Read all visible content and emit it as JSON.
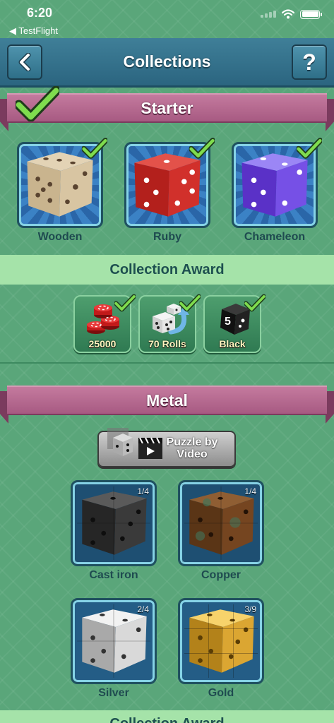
{
  "status_bar": {
    "time": "6:20",
    "back_app": "◀ TestFlight"
  },
  "navbar": {
    "title": "Collections",
    "back_icon": "chevron-left-icon",
    "help_label": "?"
  },
  "sections": {
    "starter": {
      "title": "Starter",
      "dice": [
        {
          "label": "Wooden",
          "collected": true
        },
        {
          "label": "Ruby",
          "collected": true
        },
        {
          "label": "Chameleon",
          "collected": true
        }
      ],
      "award_title": "Collection Award",
      "awards": [
        {
          "label": "25000",
          "icon": "chips-icon",
          "claimed": true
        },
        {
          "label": "70 Rolls",
          "icon": "dice-roll-icon",
          "claimed": true
        },
        {
          "label": "Black",
          "icon": "black-die-icon",
          "claimed": true
        }
      ]
    },
    "metal": {
      "title": "Metal",
      "puzzle_button": "Puzzle by Video",
      "dice": [
        {
          "label": "Cast iron",
          "count": "1/4"
        },
        {
          "label": "Copper",
          "count": "1/4"
        },
        {
          "label": "Silver",
          "count": "2/4"
        },
        {
          "label": "Gold",
          "count": "3/9"
        }
      ],
      "award_title": "Collection Award"
    }
  },
  "colors": {
    "background": "#5aa67a",
    "navbar": "#2f6d89",
    "ribbon": "#b4688e",
    "award_bar": "#a5e3a9",
    "check": "#79d24b"
  }
}
